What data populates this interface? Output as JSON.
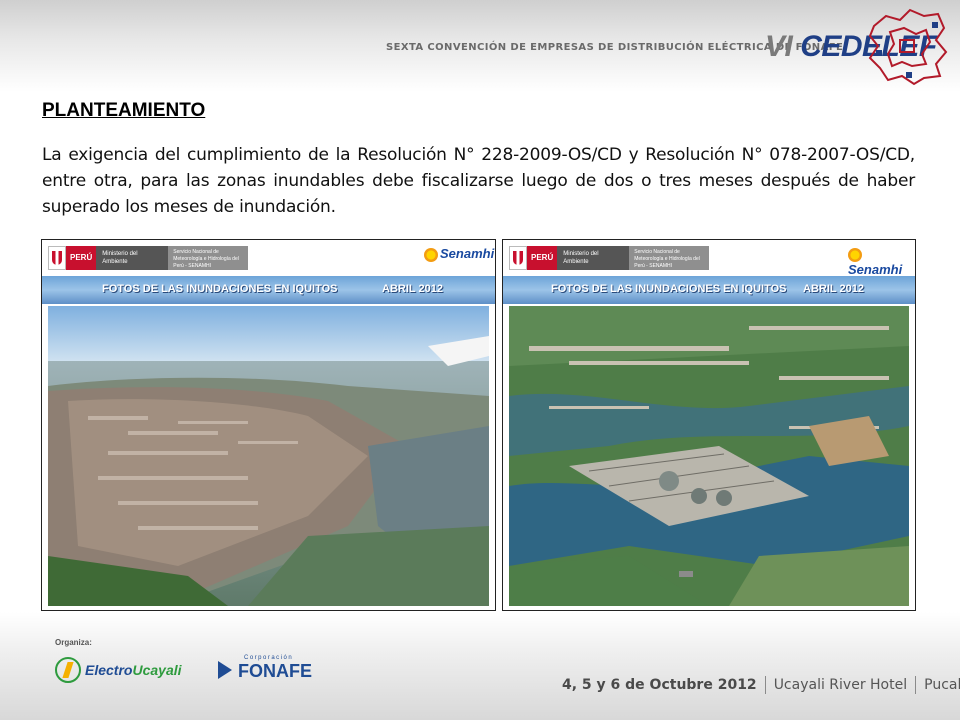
{
  "header": {
    "convention": "SEXTA CONVENCIÓN DE EMPRESAS DE DISTRIBUCIÓN ELÉCTRICA DE FONAFE",
    "brand_prefix": "VI",
    "brand_name": "CEDELEF"
  },
  "slide": {
    "title": "PLANTEAMIENTO",
    "body": "La exigencia del cumplimiento de la Resolución N° 228-2009-OS/CD y Resolución N° 078-2007-OS/CD, entre otra, para las zonas inundables debe fiscalizarse luego de dos o tres meses después de haber superado los meses de inundación."
  },
  "photos": [
    {
      "peru": "PERÚ",
      "ministry": "Ministerio del Ambiente",
      "service": "Servicio Nacional de Meteorología e Hidrología del Perú - SENAMHI",
      "agency": "Senamhi",
      "caption_left": "FOTOS DE LAS INUNDACIONES EN IQUITOS",
      "caption_right": "ABRIL 2012"
    },
    {
      "peru": "PERÚ",
      "ministry": "Ministerio del Ambiente",
      "service": "Servicio Nacional de Meteorología e Hidrología del Perú - SENAMHI",
      "agency": "Senamhi",
      "caption_left": "FOTOS DE LAS INUNDACIONES EN IQUITOS",
      "caption_right": "ABRIL 2012"
    }
  ],
  "footer": {
    "organiza": "Organiza:",
    "electro_a": "Electro",
    "electro_b": "Ucayali",
    "fonafe_corp": "Corporación",
    "fonafe_name": "FONAFE",
    "date": "4, 5 y 6 de Octubre 2012",
    "venue": "Ucayali River Hotel",
    "city": "Pucallpa"
  }
}
